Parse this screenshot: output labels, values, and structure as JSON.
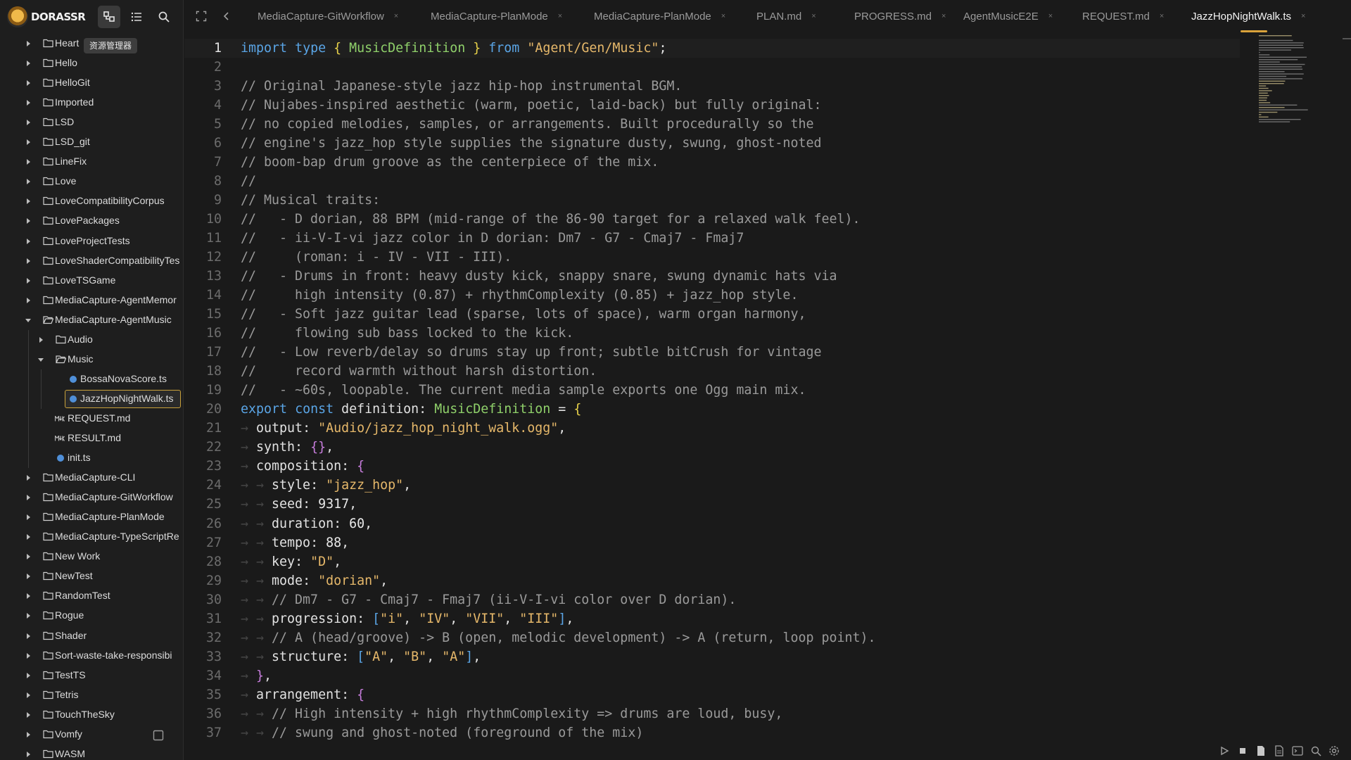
{
  "app": {
    "logo_text": "DORASSR",
    "tooltip": "资源管理器",
    "colors": {
      "accent": "#d9a23a",
      "selection_border": "#c9a13a",
      "ts_icon": "#4f8fd8"
    }
  },
  "toolbar": {
    "icons": [
      "explorer-icon",
      "outline-list-icon",
      "search-icon"
    ]
  },
  "tree": {
    "items": [
      {
        "label": "Heart",
        "kind": "folder",
        "depth": 0,
        "expanded": false
      },
      {
        "label": "Hello",
        "kind": "folder",
        "depth": 0,
        "expanded": false
      },
      {
        "label": "HelloGit",
        "kind": "folder",
        "depth": 0,
        "expanded": false
      },
      {
        "label": "Imported",
        "kind": "folder",
        "depth": 0,
        "expanded": false
      },
      {
        "label": "LSD",
        "kind": "folder",
        "depth": 0,
        "expanded": false
      },
      {
        "label": "LSD_git",
        "kind": "folder",
        "depth": 0,
        "expanded": false
      },
      {
        "label": "LineFix",
        "kind": "folder",
        "depth": 0,
        "expanded": false
      },
      {
        "label": "Love",
        "kind": "folder",
        "depth": 0,
        "expanded": false
      },
      {
        "label": "LoveCompatibilityCorpus",
        "kind": "folder",
        "depth": 0,
        "expanded": false
      },
      {
        "label": "LovePackages",
        "kind": "folder",
        "depth": 0,
        "expanded": false
      },
      {
        "label": "LoveProjectTests",
        "kind": "folder",
        "depth": 0,
        "expanded": false
      },
      {
        "label": "LoveShaderCompatibilityTes",
        "kind": "folder",
        "depth": 0,
        "expanded": false
      },
      {
        "label": "LoveTSGame",
        "kind": "folder",
        "depth": 0,
        "expanded": false
      },
      {
        "label": "MediaCapture-AgentMemor",
        "kind": "folder",
        "depth": 0,
        "expanded": false
      },
      {
        "label": "MediaCapture-AgentMusic",
        "kind": "folder",
        "depth": 0,
        "expanded": true
      },
      {
        "label": "Audio",
        "kind": "folder",
        "depth": 1,
        "expanded": false
      },
      {
        "label": "Music",
        "kind": "folder",
        "depth": 1,
        "expanded": true
      },
      {
        "label": "BossaNovaScore.ts",
        "kind": "ts",
        "depth": 2
      },
      {
        "label": "JazzHopNightWalk.ts",
        "kind": "ts",
        "depth": 2,
        "selected": true
      },
      {
        "label": "REQUEST.md",
        "kind": "md",
        "depth": 1
      },
      {
        "label": "RESULT.md",
        "kind": "md",
        "depth": 1
      },
      {
        "label": "init.ts",
        "kind": "ts",
        "depth": 1
      },
      {
        "label": "MediaCapture-CLI",
        "kind": "folder",
        "depth": 0,
        "expanded": false
      },
      {
        "label": "MediaCapture-GitWorkflow",
        "kind": "folder",
        "depth": 0,
        "expanded": false
      },
      {
        "label": "MediaCapture-PlanMode",
        "kind": "folder",
        "depth": 0,
        "expanded": false
      },
      {
        "label": "MediaCapture-TypeScriptRe",
        "kind": "folder",
        "depth": 0,
        "expanded": false
      },
      {
        "label": "New Work",
        "kind": "folder",
        "depth": 0,
        "expanded": false
      },
      {
        "label": "NewTest",
        "kind": "folder",
        "depth": 0,
        "expanded": false
      },
      {
        "label": "RandomTest",
        "kind": "folder",
        "depth": 0,
        "expanded": false
      },
      {
        "label": "Rogue",
        "kind": "folder",
        "depth": 0,
        "expanded": false
      },
      {
        "label": "Shader",
        "kind": "folder",
        "depth": 0,
        "expanded": false
      },
      {
        "label": "Sort-waste-take-responsibi",
        "kind": "folder",
        "depth": 0,
        "expanded": false
      },
      {
        "label": "TestTS",
        "kind": "folder",
        "depth": 0,
        "expanded": false
      },
      {
        "label": "Tetris",
        "kind": "folder",
        "depth": 0,
        "expanded": false
      },
      {
        "label": "TouchTheSky",
        "kind": "folder",
        "depth": 0,
        "expanded": false
      },
      {
        "label": "Vomfy",
        "kind": "folder",
        "depth": 0,
        "expanded": false
      },
      {
        "label": "WASM",
        "kind": "folder",
        "depth": 0,
        "expanded": false
      }
    ]
  },
  "tabs": [
    {
      "label": "MediaCapture-GitWorkflow",
      "active": false
    },
    {
      "label": "MediaCapture-PlanMode",
      "active": false
    },
    {
      "label": "MediaCapture-PlanMode",
      "active": false
    },
    {
      "label": "PLAN.md",
      "active": false
    },
    {
      "label": "PROGRESS.md",
      "active": false
    },
    {
      "label": "AgentMusicE2E",
      "active": false
    },
    {
      "label": "REQUEST.md",
      "active": false
    },
    {
      "label": "JazzHopNightWalk.ts",
      "active": true
    }
  ],
  "tab_close_glyph": "×",
  "editor": {
    "current_line": 1,
    "lines": [
      {
        "n": "1",
        "tokens": [
          [
            "kw",
            "import"
          ],
          [
            "sp",
            " "
          ],
          [
            "kw",
            "type"
          ],
          [
            "sp",
            " "
          ],
          [
            "br1",
            "{"
          ],
          [
            "sp",
            " "
          ],
          [
            "type",
            "MusicDefinition"
          ],
          [
            "sp",
            " "
          ],
          [
            "br1",
            "}"
          ],
          [
            "sp",
            " "
          ],
          [
            "kw",
            "from"
          ],
          [
            "sp",
            " "
          ],
          [
            "str",
            "\"Agent/Gen/Music\""
          ],
          [
            "pn",
            ";"
          ]
        ]
      },
      {
        "n": "2",
        "tokens": []
      },
      {
        "n": "3",
        "tokens": [
          [
            "cm",
            "// Original Japanese-style jazz hip-hop instrumental BGM."
          ]
        ]
      },
      {
        "n": "4",
        "tokens": [
          [
            "cm",
            "// Nujabes-inspired aesthetic (warm, poetic, laid-back) but fully original:"
          ]
        ]
      },
      {
        "n": "5",
        "tokens": [
          [
            "cm",
            "// no copied melodies, samples, or arrangements. Built procedurally so the"
          ]
        ]
      },
      {
        "n": "6",
        "tokens": [
          [
            "cm",
            "// engine's jazz_hop style supplies the signature dusty, swung, ghost-noted"
          ]
        ]
      },
      {
        "n": "7",
        "tokens": [
          [
            "cm",
            "// boom-bap drum groove as the centerpiece of the mix."
          ]
        ]
      },
      {
        "n": "8",
        "tokens": [
          [
            "cm",
            "//"
          ]
        ]
      },
      {
        "n": "9",
        "tokens": [
          [
            "cm",
            "// Musical traits:"
          ]
        ]
      },
      {
        "n": "10",
        "tokens": [
          [
            "cm",
            "//   - D dorian, 88 BPM (mid-range of the 86-90 target for a relaxed walk feel)."
          ]
        ]
      },
      {
        "n": "11",
        "tokens": [
          [
            "cm",
            "//   - ii-V-I-vi jazz color in D dorian: Dm7 - G7 - Cmaj7 - Fmaj7"
          ]
        ]
      },
      {
        "n": "12",
        "tokens": [
          [
            "cm",
            "//     (roman: i - IV - VII - III)."
          ]
        ]
      },
      {
        "n": "13",
        "tokens": [
          [
            "cm",
            "//   - Drums in front: heavy dusty kick, snappy snare, swung dynamic hats via"
          ]
        ]
      },
      {
        "n": "14",
        "tokens": [
          [
            "cm",
            "//     high intensity (0.87) + rhythmComplexity (0.85) + jazz_hop style."
          ]
        ]
      },
      {
        "n": "15",
        "tokens": [
          [
            "cm",
            "//   - Soft jazz guitar lead (sparse, lots of space), warm organ harmony,"
          ]
        ]
      },
      {
        "n": "16",
        "tokens": [
          [
            "cm",
            "//     flowing sub bass locked to the kick."
          ]
        ]
      },
      {
        "n": "17",
        "tokens": [
          [
            "cm",
            "//   - Low reverb/delay so drums stay up front; subtle bitCrush for vintage"
          ]
        ]
      },
      {
        "n": "18",
        "tokens": [
          [
            "cm",
            "//     record warmth without harsh distortion."
          ]
        ]
      },
      {
        "n": "19",
        "tokens": [
          [
            "cm",
            "//   - ~60s, loopable. The current media sample exports one Ogg main mix."
          ]
        ]
      },
      {
        "n": "20",
        "tokens": [
          [
            "kw",
            "export"
          ],
          [
            "sp",
            " "
          ],
          [
            "kw",
            "const"
          ],
          [
            "sp",
            " "
          ],
          [
            "id",
            "definition"
          ],
          [
            "pn",
            ": "
          ],
          [
            "type",
            "MusicDefinition"
          ],
          [
            "sp",
            " "
          ],
          [
            "pn",
            "= "
          ],
          [
            "br1",
            "{"
          ]
        ]
      },
      {
        "n": "21",
        "tokens": [
          [
            "ig",
            "→ "
          ],
          [
            "prop",
            "output"
          ],
          [
            "pn",
            ": "
          ],
          [
            "str",
            "\"Audio/jazz_hop_night_walk.ogg\""
          ],
          [
            "pn",
            ","
          ]
        ]
      },
      {
        "n": "22",
        "tokens": [
          [
            "ig",
            "→ "
          ],
          [
            "prop",
            "synth"
          ],
          [
            "pn",
            ": "
          ],
          [
            "br2",
            "{}"
          ],
          [
            "pn",
            ","
          ]
        ]
      },
      {
        "n": "23",
        "tokens": [
          [
            "ig",
            "→ "
          ],
          [
            "prop",
            "composition"
          ],
          [
            "pn",
            ": "
          ],
          [
            "br2",
            "{"
          ]
        ]
      },
      {
        "n": "24",
        "tokens": [
          [
            "ig",
            "→ → "
          ],
          [
            "prop",
            "style"
          ],
          [
            "pn",
            ": "
          ],
          [
            "str",
            "\"jazz_hop\""
          ],
          [
            "pn",
            ","
          ]
        ]
      },
      {
        "n": "25",
        "tokens": [
          [
            "ig",
            "→ → "
          ],
          [
            "prop",
            "seed"
          ],
          [
            "pn",
            ": "
          ],
          [
            "num",
            "9317"
          ],
          [
            "pn",
            ","
          ]
        ]
      },
      {
        "n": "26",
        "tokens": [
          [
            "ig",
            "→ → "
          ],
          [
            "prop",
            "duration"
          ],
          [
            "pn",
            ": "
          ],
          [
            "num",
            "60"
          ],
          [
            "pn",
            ","
          ]
        ]
      },
      {
        "n": "27",
        "tokens": [
          [
            "ig",
            "→ → "
          ],
          [
            "prop",
            "tempo"
          ],
          [
            "pn",
            ": "
          ],
          [
            "num",
            "88"
          ],
          [
            "pn",
            ","
          ]
        ]
      },
      {
        "n": "28",
        "tokens": [
          [
            "ig",
            "→ → "
          ],
          [
            "prop",
            "key"
          ],
          [
            "pn",
            ": "
          ],
          [
            "str",
            "\"D\""
          ],
          [
            "pn",
            ","
          ]
        ]
      },
      {
        "n": "29",
        "tokens": [
          [
            "ig",
            "→ → "
          ],
          [
            "prop",
            "mode"
          ],
          [
            "pn",
            ": "
          ],
          [
            "str",
            "\"dorian\""
          ],
          [
            "pn",
            ","
          ]
        ]
      },
      {
        "n": "30",
        "tokens": [
          [
            "ig",
            "→ → "
          ],
          [
            "cm",
            "// Dm7 - G7 - Cmaj7 - Fmaj7 (ii-V-I-vi color over D dorian)."
          ]
        ]
      },
      {
        "n": "31",
        "tokens": [
          [
            "ig",
            "→ → "
          ],
          [
            "prop",
            "progression"
          ],
          [
            "pn",
            ": "
          ],
          [
            "br3",
            "["
          ],
          [
            "str",
            "\"i\""
          ],
          [
            "pn",
            ", "
          ],
          [
            "str",
            "\"IV\""
          ],
          [
            "pn",
            ", "
          ],
          [
            "str",
            "\"VII\""
          ],
          [
            "pn",
            ", "
          ],
          [
            "str",
            "\"III\""
          ],
          [
            "br3",
            "]"
          ],
          [
            "pn",
            ","
          ]
        ]
      },
      {
        "n": "32",
        "tokens": [
          [
            "ig",
            "→ → "
          ],
          [
            "cm",
            "// A (head/groove) -> B (open, melodic development) -> A (return, loop point)."
          ]
        ]
      },
      {
        "n": "33",
        "tokens": [
          [
            "ig",
            "→ → "
          ],
          [
            "prop",
            "structure"
          ],
          [
            "pn",
            ": "
          ],
          [
            "br3",
            "["
          ],
          [
            "str",
            "\"A\""
          ],
          [
            "pn",
            ", "
          ],
          [
            "str",
            "\"B\""
          ],
          [
            "pn",
            ", "
          ],
          [
            "str",
            "\"A\""
          ],
          [
            "br3",
            "]"
          ],
          [
            "pn",
            ","
          ]
        ]
      },
      {
        "n": "34",
        "tokens": [
          [
            "ig",
            "→ "
          ],
          [
            "br2",
            "}"
          ],
          [
            "pn",
            ","
          ]
        ]
      },
      {
        "n": "35",
        "tokens": [
          [
            "ig",
            "→ "
          ],
          [
            "prop",
            "arrangement"
          ],
          [
            "pn",
            ": "
          ],
          [
            "br2",
            "{"
          ]
        ]
      },
      {
        "n": "36",
        "tokens": [
          [
            "ig",
            "→ → "
          ],
          [
            "cm",
            "// High intensity + high rhythmComplexity => drums are loud, busy,"
          ]
        ]
      },
      {
        "n": "37",
        "tokens": [
          [
            "ig",
            "→ → "
          ],
          [
            "cm",
            "// swung and ghost-noted (foreground of the mix)"
          ]
        ]
      }
    ]
  },
  "statusbar": {
    "icons": [
      "play-icon",
      "stop-icon",
      "new-file-icon",
      "document-icon",
      "terminal-icon",
      "search-icon",
      "gear-icon"
    ]
  }
}
